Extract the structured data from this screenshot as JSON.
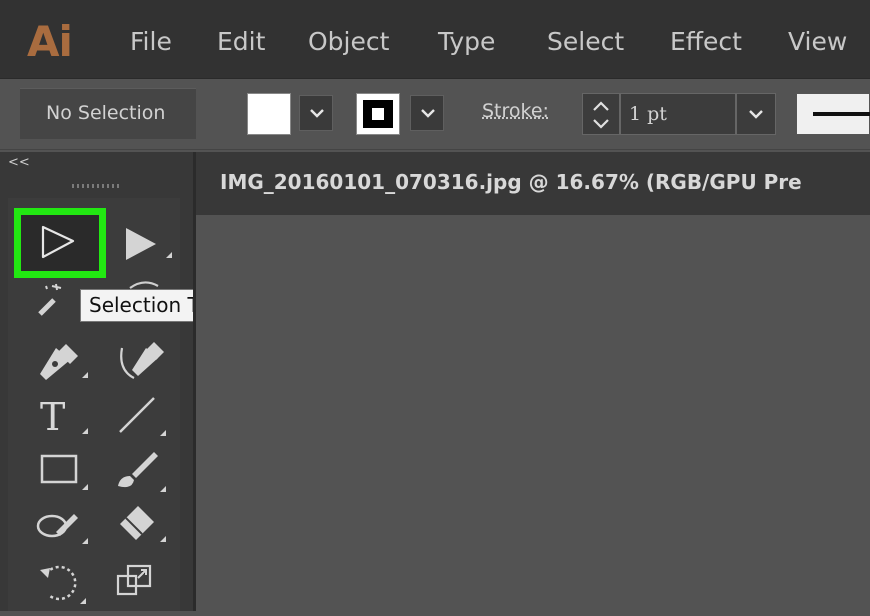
{
  "app": {
    "logo": "Ai",
    "brand_color": "#a96c3f"
  },
  "menu": {
    "items": [
      "File",
      "Edit",
      "Object",
      "Type",
      "Select",
      "Effect",
      "View"
    ]
  },
  "control_bar": {
    "selection_status": "No Selection",
    "fill_color": "#ffffff",
    "stroke_label": "Stroke:",
    "stroke_weight": "1 pt"
  },
  "document": {
    "tab_title": "IMG_20160101_070316.jpg @ 16.67% (RGB/GPU Pre"
  },
  "toolbar": {
    "collapse_label": "<<",
    "tools": [
      {
        "name": "selection-tool",
        "icon": "selection-arrow-icon",
        "selected": true
      },
      {
        "name": "direct-selection-tool",
        "icon": "direct-selection-arrow-icon"
      },
      {
        "name": "magic-wand-tool",
        "icon": "magic-wand-icon"
      },
      {
        "name": "lasso-tool",
        "icon": "lasso-icon"
      },
      {
        "name": "pen-tool",
        "icon": "pen-icon"
      },
      {
        "name": "curvature-tool",
        "icon": "curvature-icon"
      },
      {
        "name": "type-tool",
        "icon": "type-icon"
      },
      {
        "name": "line-segment-tool",
        "icon": "line-segment-icon"
      },
      {
        "name": "rectangle-tool",
        "icon": "rectangle-icon"
      },
      {
        "name": "paintbrush-tool",
        "icon": "paintbrush-icon"
      },
      {
        "name": "shaper-tool",
        "icon": "shaper-icon"
      },
      {
        "name": "eraser-tool",
        "icon": "eraser-icon"
      },
      {
        "name": "rotate-tool",
        "icon": "rotate-icon"
      },
      {
        "name": "scale-tool",
        "icon": "scale-icon"
      }
    ]
  },
  "tooltip": {
    "text": "Selection Tool (V)"
  },
  "highlight_color": "#22e812"
}
